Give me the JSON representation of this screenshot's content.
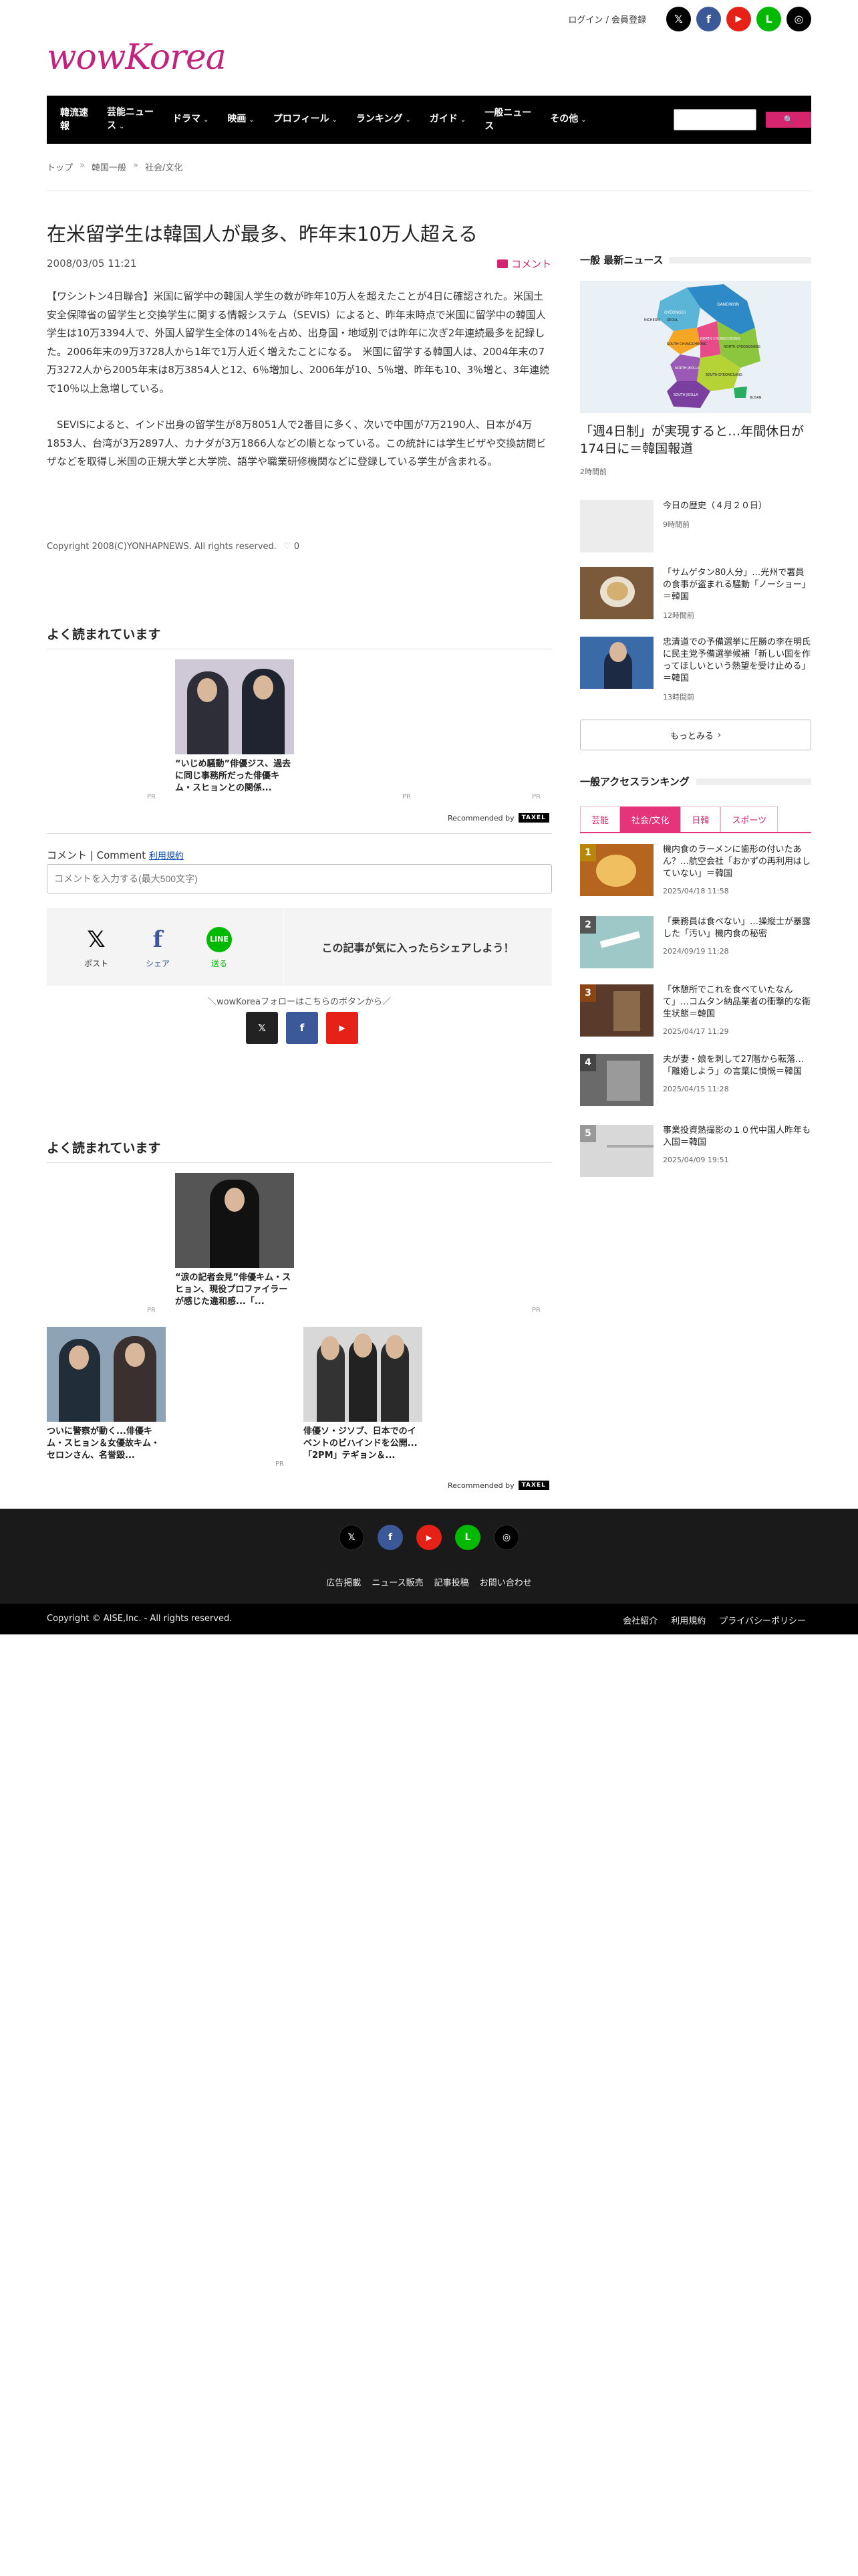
{
  "header": {
    "login": "ログイン / 会員登録",
    "logo": "wowKorea",
    "social": [
      {
        "name": "x-icon",
        "glyph": "𝕏",
        "bg": "#000000"
      },
      {
        "name": "facebook-icon",
        "glyph": "f",
        "bg": "#3b5998"
      },
      {
        "name": "youtube-icon",
        "glyph": "▶",
        "bg": "#e62117"
      },
      {
        "name": "line-icon",
        "glyph": "L",
        "bg": "#00b900"
      },
      {
        "name": "instagram-icon",
        "glyph": "◎",
        "bg": "#000000"
      }
    ]
  },
  "nav": {
    "items": [
      {
        "l1": "韓流速",
        "l2": "報",
        "chev": false
      },
      {
        "l1": "芸能ニュー",
        "l2": "ス",
        "chev": true
      },
      {
        "l1": "ドラマ",
        "l2": "",
        "chev": true
      },
      {
        "l1": "映画",
        "l2": "",
        "chev": true
      },
      {
        "l1": "プロフィール",
        "l2": "",
        "chev": true
      },
      {
        "l1": "ランキング",
        "l2": "",
        "chev": true
      },
      {
        "l1": "ガイド",
        "l2": "",
        "chev": true
      },
      {
        "l1": "一般ニュー",
        "l2": "ス",
        "chev": false
      },
      {
        "l1": "その他",
        "l2": "",
        "chev": true
      }
    ],
    "search_button": "🔍"
  },
  "breadcrumb": [
    "トップ",
    "韓国一般",
    "社会/文化"
  ],
  "article": {
    "title": "在米留学生は韓国人が最多、昨年末10万人超える",
    "date": "2008/03/05 11:21",
    "comment_label": "コメント",
    "paragraphs": [
      "【ワシントン4日聯合】米国に留学中の韓国人学生の数が昨年10万人を超えたことが4日に確認された。米国土安全保障省の留学生と交換学生に関する情報システム（SEVIS）によると、昨年末時点で米国に留学中の韓国人学生は10万3394人で、外国人留学生全体の14％を占め、出身国・地域別では昨年に次ぎ2年連続最多を記録した。2006年末の9万3728人から1年で1万人近く増えたことになる。　米国に留学する韓国人は、2004年末の7万3272人から2005年末は8万3854人と12、6％増加し、2006年が10、5％増、昨年も10、3％増と、3年連続で10％以上急増している。",
      "　SEVISによると、インド出身の留学生が8万8051人で2番目に多く、次いで中国が7万2190人、日本が4万1853人、台湾が3万2897人、カナダが3万1866人などの順となっている。この統計には学生ビザや交換訪問ビザなどを取得し米国の正規大学と大学院、語学や職業研修機関などに登録している学生が含まれる。"
    ],
    "copyright": "Copyright 2008(C)YONHAPNEWS. All rights reserved.",
    "like_count": "0"
  },
  "popular1": {
    "title": "よく読まれています",
    "card_text": "“いじめ騒動”俳優ジス、過去に同じ事務所だった俳優キム・スヒョンとの関係...",
    "pr": "PR",
    "recommended": "Recommended by",
    "rec_logo": "TAXEL"
  },
  "comment_box": {
    "label": "コメント | Comment",
    "terms": "利用規約",
    "placeholder": "コメントを入力する(最大500文字)"
  },
  "share": {
    "items": [
      {
        "name": "post-share",
        "glyph": "𝕏",
        "label": "ポスト",
        "color": "#000000"
      },
      {
        "name": "facebook-share",
        "glyph": "f",
        "label": "シェア",
        "color": "#3b5998"
      },
      {
        "name": "line-share",
        "glyph": "LINE",
        "label": "送る",
        "color": "#00b900"
      }
    ],
    "message": "この記事が気に入ったらシェアしよう！",
    "follow_text": "＼wowKoreaフォローはこちらのボタンから／"
  },
  "popular2": {
    "title": "よく読まれています",
    "cards": [
      {
        "text": "“涙の記者会見”俳優キム・スヒョン、現役プロファイラーが感じた違和感...「..."
      },
      {
        "text": "ついに警察が動く...俳優キム・スヒョン＆女優故キム・セロンさん、名誉毀..."
      },
      {
        "text": "俳優ソ・ジソブ、日本でのイベントのビハインドを公開...「2PM」テギョン＆..."
      }
    ]
  },
  "sidebar": {
    "news_title": "一般 最新ニュース",
    "lead_title": "「週4日制」が実現すると…年間休日が174日に＝韓国報道",
    "lead_time": "2時間前",
    "map_labels": [
      "GANGWON",
      "GYEONGGI",
      "SEOUL",
      "INCHEON",
      "NORTH CHUNGCHEONG",
      "SOUTH CHUNGCHEONG",
      "NORTH GYEONGSANG",
      "SOUTH GYEONGSANG",
      "NORTH JEOLLA",
      "SOUTH JEOLLA",
      "BUSAN"
    ],
    "news": [
      {
        "title": "今日の歴史（４月２０日）",
        "time": "9時間前"
      },
      {
        "title": "「サムゲタン80人分」…光州で署員の食事が盗まれる騒動「ノーショー」＝韓国",
        "time": "12時間前"
      },
      {
        "title": "忠清道での予備選挙に圧勝の李在明氏に民主党予備選挙候補「新しい国を作ってほしいという熱望を受け止める」＝韓国",
        "time": "13時間前"
      }
    ],
    "more": "もっとみる",
    "ranking_title": "一般アクセスランキング",
    "tabs": [
      "芸能",
      "社会/文化",
      "日韓",
      "スポーツ"
    ],
    "active_tab": 1,
    "ranking": [
      {
        "num": "1",
        "title": "機内食のラーメンに歯形の付いたあん？…航空会社「おかずの再利用はしていない」＝韓国",
        "date": "2025/04/18 11:58",
        "color": "#b8860b"
      },
      {
        "num": "2",
        "title": "「乗務員は食べない」…操縦士が暴露した「汚い」機内食の秘密",
        "date": "2024/09/19 11:28",
        "color": "#777777"
      },
      {
        "num": "3",
        "title": "「休憩所でこれを食べていたなんて」…コムタン納品業者の衝撃的な衛生状態＝韓国",
        "date": "2025/04/17 11:29",
        "color": "#8b4513"
      },
      {
        "num": "4",
        "title": "夫が妻・娘を刺して27階から転落…「離婚しよう」の言葉に憤慨＝韓国",
        "date": "2025/04/15 11:28",
        "color": "#555555"
      },
      {
        "num": "5",
        "title": "事業投資熱撮影の１０代中国人昨年も入国＝韓国",
        "date": "2025/04/09 19:51",
        "color": "#999999"
      }
    ]
  },
  "footer": {
    "links": [
      "広告掲載",
      "ニュース販売",
      "記事投稿",
      "お問い合わせ"
    ],
    "copyright": "Copyright © AISE,Inc. - All rights reserved.",
    "bottom_links": [
      "会社紹介",
      "利用規約",
      "プライバシーポリシー"
    ]
  }
}
